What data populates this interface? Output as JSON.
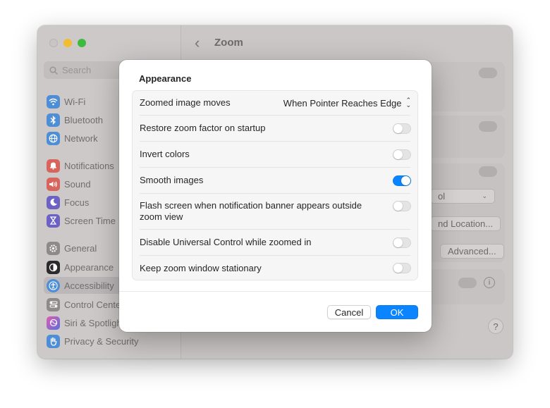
{
  "colors": {
    "accent": "#0a84ff",
    "traffic_min": "#f2bd30",
    "traffic_max": "#3dbb3f"
  },
  "window": {
    "title": "Zoom",
    "search_placeholder": "Search"
  },
  "sidebar": {
    "items": [
      {
        "label": "Wi-Fi",
        "icon": "wifi-icon",
        "color": "#4e8ed6"
      },
      {
        "label": "Bluetooth",
        "icon": "bluetooth-icon",
        "color": "#4e8ed6"
      },
      {
        "label": "Network",
        "icon": "globe-icon",
        "color": "#4e8ed6"
      },
      {
        "label": "Notifications",
        "icon": "bell-icon",
        "color": "#d9645c"
      },
      {
        "label": "Sound",
        "icon": "speaker-icon",
        "color": "#d9645c"
      },
      {
        "label": "Focus",
        "icon": "moon-icon",
        "color": "#6d62c4"
      },
      {
        "label": "Screen Time",
        "icon": "hourglass-icon",
        "color": "#6d62c4"
      },
      {
        "label": "General",
        "icon": "gear-icon",
        "color": "#8e8a8a"
      },
      {
        "label": "Appearance",
        "icon": "appearance-icon",
        "color": "#2b2b2b"
      },
      {
        "label": "Accessibility",
        "icon": "accessibility-icon",
        "color": "#4e8ed6"
      },
      {
        "label": "Control Cente",
        "icon": "control-center-icon",
        "color": "#8e8a8a"
      },
      {
        "label": "Siri & Spotligh",
        "icon": "siri-icon",
        "color": "#a05fb8"
      },
      {
        "label": "Privacy & Security",
        "icon": "hand-icon",
        "color": "#4e8ed6"
      }
    ]
  },
  "background": {
    "location_button": "nd Location...",
    "advanced_button": "Advanced...",
    "select_partial": "ol",
    "help": "?"
  },
  "dialog": {
    "title": "Appearance",
    "rows": [
      {
        "label": "Zoomed image moves",
        "type": "popup",
        "value": "When Pointer Reaches Edge"
      },
      {
        "label": "Restore zoom factor on startup",
        "type": "toggle",
        "on": false
      },
      {
        "label": "Invert colors",
        "type": "toggle",
        "on": false
      },
      {
        "label": "Smooth images",
        "type": "toggle",
        "on": true
      },
      {
        "label": "Flash screen when notification banner appears outside zoom view",
        "type": "toggle",
        "on": false
      },
      {
        "label": "Disable Universal Control while zoomed in",
        "type": "toggle",
        "on": false
      },
      {
        "label": "Keep zoom window stationary",
        "type": "toggle",
        "on": false
      }
    ],
    "cancel_label": "Cancel",
    "ok_label": "OK"
  }
}
